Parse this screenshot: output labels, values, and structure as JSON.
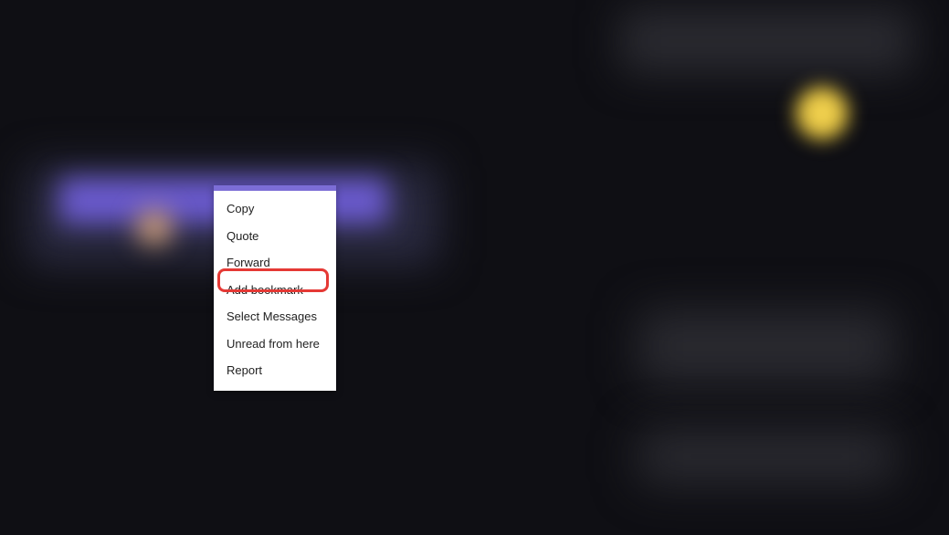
{
  "context_menu": {
    "items": [
      {
        "label": "Copy"
      },
      {
        "label": "Quote"
      },
      {
        "label": "Forward"
      },
      {
        "label": "Add bookmark"
      },
      {
        "label": "Select Messages"
      },
      {
        "label": "Unread from here"
      },
      {
        "label": "Report"
      }
    ]
  },
  "highlighted_item_index": 3
}
